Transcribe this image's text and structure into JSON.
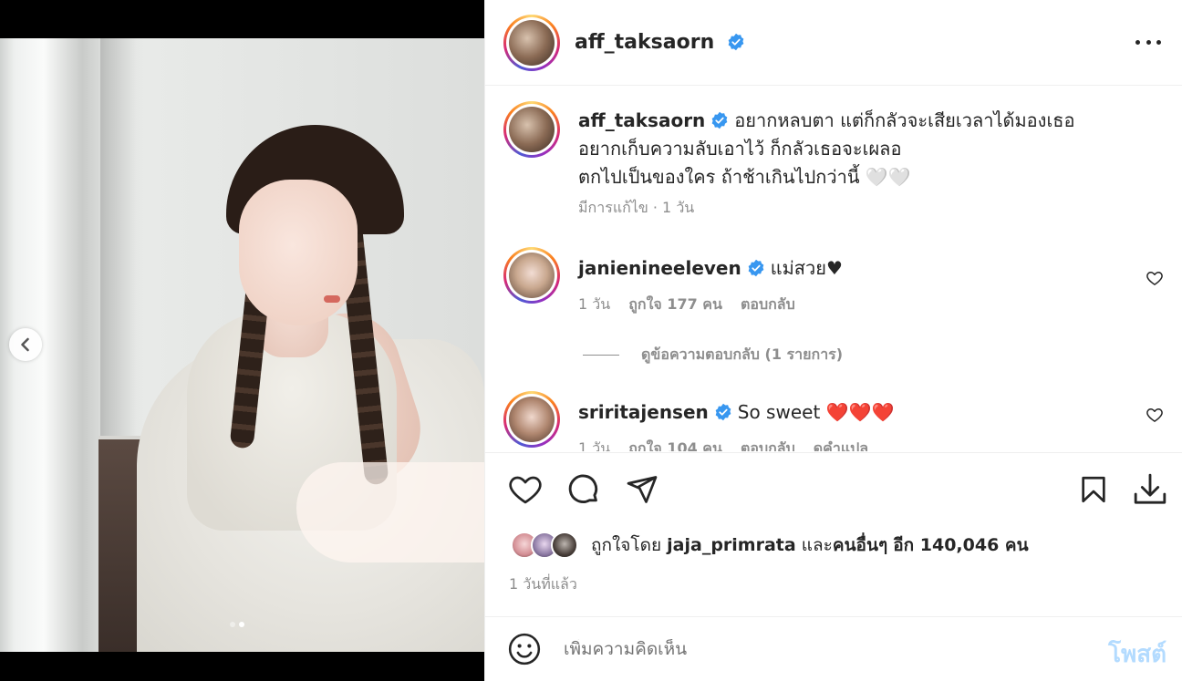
{
  "post": {
    "author": "aff_taksaorn",
    "image_alt": "Woman with braided hair in a white dress",
    "carousel_dots": 2,
    "carousel_active": 1
  },
  "caption": {
    "username": "aff_taksaorn",
    "line1": "อยากหลบตา แต่ก็กลัวจะเสียเวลาได้มองเธอ",
    "line2": "อยากเก็บความลับเอาไว้ ก็กลัวเธอจะเผลอ",
    "line3": "ตกไปเป็นของใคร ถ้าช้าเกินไปกว่านี้ 🤍🤍",
    "meta": "มีการแก้ไข · 1 วัน"
  },
  "comments": [
    {
      "username": "janienineeleven",
      "text": "แม่สวย♥",
      "time": "1 วัน",
      "likes": "ถูกใจ 177 คน",
      "reply": "ตอบกลับ"
    },
    {
      "username": "sriritajensen",
      "text": "So sweet ❤️❤️❤️",
      "time": "1 วัน",
      "likes": "ถูกใจ 104 คน",
      "reply": "ตอบกลับ",
      "translate": "ดูคำแปล"
    }
  ],
  "view_replies": "ดูข้อความตอบกลับ (1 รายการ)",
  "likes": {
    "prefix": "ถูกใจโดย",
    "first_user": "jaja_primrata",
    "and": "และ",
    "others": "คนอื่นๆ",
    "count_text": "อีก 140,046 คน"
  },
  "post_time": "1 วันที่แล้ว",
  "add_comment": {
    "placeholder": "เพิ่มความคิดเห็น",
    "post_label": "โพสต์"
  },
  "colors": {
    "verified": "#3897f0",
    "post_disabled": "#b3dbff",
    "muted_text": "#8e8e8e"
  }
}
